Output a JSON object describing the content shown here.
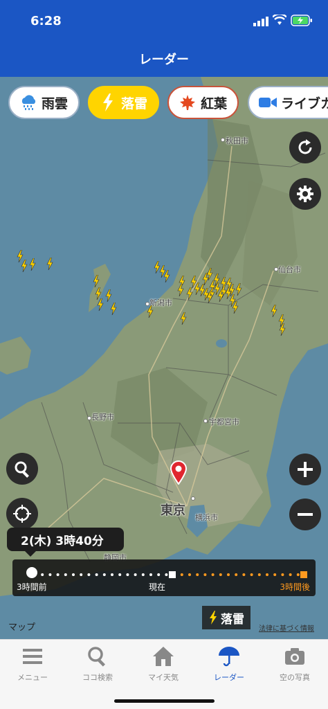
{
  "status": {
    "time": "6:28"
  },
  "header": {
    "title": "レーダー"
  },
  "chips": [
    {
      "label": "雨雲",
      "icon": "rain-cloud-icon"
    },
    {
      "label": "落雷",
      "icon": "lightning-icon",
      "active": true
    },
    {
      "label": "紅葉",
      "icon": "maple-leaf-icon"
    },
    {
      "label": "ライブカ",
      "icon": "video-camera-icon"
    }
  ],
  "map": {
    "cities": [
      {
        "label": "秋田市"
      },
      {
        "label": "仙台市"
      },
      {
        "label": "新潟市"
      },
      {
        "label": "長野市"
      },
      {
        "label": "宇都宮市"
      },
      {
        "label": "東京"
      },
      {
        "label": "横浜市"
      },
      {
        "label": "静岡市"
      }
    ],
    "lightning_count": 40
  },
  "timeline": {
    "current_label": "2(木) 3時40分",
    "past_label": "3時間前",
    "now_label": "現在",
    "future_label": "3時間後"
  },
  "legend": {
    "label": "落雷"
  },
  "attribution": {
    "maps": "マップ",
    "legal": "法律に基づく情報"
  },
  "tabs": [
    {
      "label": "メニュー",
      "icon": "menu-icon"
    },
    {
      "label": "ココ検索",
      "icon": "search-icon"
    },
    {
      "label": "マイ天気",
      "icon": "home-icon"
    },
    {
      "label": "レーダー",
      "icon": "umbrella-icon",
      "active": true
    },
    {
      "label": "空の写真",
      "icon": "camera-icon"
    }
  ],
  "colors": {
    "header": "#1b56c4",
    "accent_yellow": "#ffd400",
    "future_orange": "#ff9a1f"
  }
}
